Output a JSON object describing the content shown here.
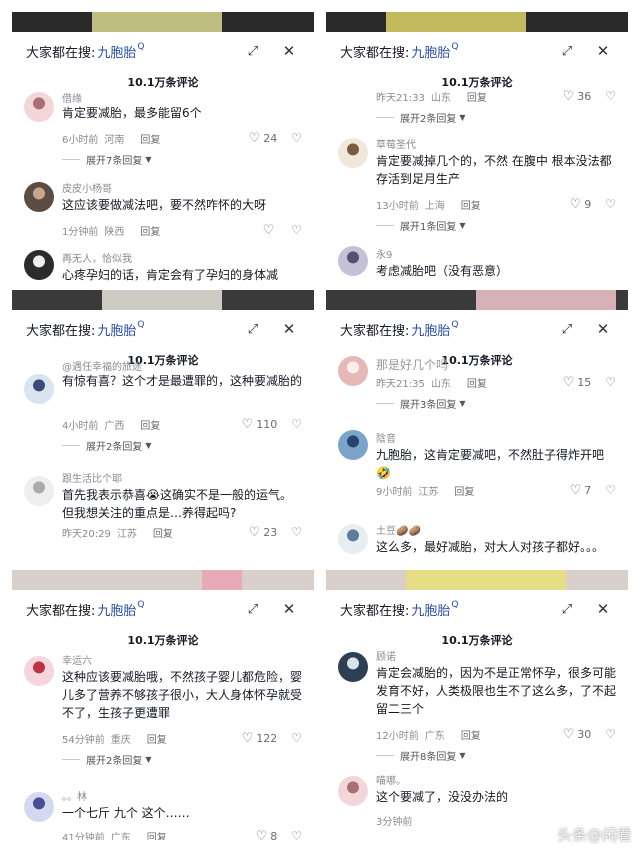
{
  "search_label": "大家都在搜:",
  "search_keyword": "九胞胎",
  "comment_count": "10.1万条评论",
  "watermark": "头条@闲看",
  "panels": [
    {
      "items": [
        {
          "name": "借缘",
          "text": "肯定要减胎，最多能留6个",
          "time": "6小时前",
          "loc": "河南",
          "likes": "24",
          "reply": "回复",
          "expand": "展开7条回复"
        },
        {
          "name": "皮皮小杨哥",
          "text": "这应该要做减法吧，要不然咋怀的大呀",
          "time": "1分钟前",
          "loc": "陕西",
          "likes": "",
          "reply": "回复"
        },
        {
          "name": "再无人，恰似我",
          "text": "心疼孕妇的话，肯定会有了孕妇的身体减"
        }
      ]
    },
    {
      "items": [
        {
          "time": "昨天21:33",
          "loc": "山东",
          "likes": "36",
          "reply": "回复",
          "expand": "展开2条回复"
        },
        {
          "name": "草莓圣代",
          "text": "肯定要减掉几个的，不然 在腹中 根本没法都存活到足月生产",
          "time": "13小时前",
          "loc": "上海",
          "likes": "9",
          "reply": "回复",
          "expand": "展开1条回复"
        },
        {
          "name": "永9",
          "text": "考虑减胎吧（没有恶意）"
        }
      ]
    },
    {
      "items": [
        {
          "name": "@遇任幸福的旅途",
          "text": "有惊有喜？这个才是最遭罪的，这种要减胎的",
          "time": "4小时前",
          "loc": "广西",
          "likes": "110",
          "reply": "回复",
          "expand": "展开2条回复"
        },
        {
          "name": "跟生活比个耶",
          "text": "首先我表示恭喜😭这确实不是一般的运气。但我想关注的重点是…养得起吗?",
          "time": "昨天20:29",
          "loc": "江苏",
          "likes": "23",
          "reply": "回复"
        }
      ]
    },
    {
      "items": [
        {
          "text": "那是好几个吗",
          "time": "昨天21:35",
          "loc": "山东",
          "likes": "15",
          "reply": "回复",
          "expand": "展开3条回复"
        },
        {
          "name": "陰音",
          "text": "九胞胎，这肯定要减吧，不然肚子得炸开吧🤣",
          "time": "9小时前",
          "loc": "江苏",
          "likes": "7",
          "reply": "回复"
        },
        {
          "name": "土豆🥔🥔",
          "text": "这么多，最好减胎，对大人对孩子都好。。。"
        }
      ]
    },
    {
      "items": [
        {
          "name": "幸运六",
          "text": "这种应该要减胎哦，不然孩子婴儿都危险，婴儿多了营养不够孩子很小，大人身体怀孕就受不了，生孩子更遭罪",
          "time": "54分钟前",
          "loc": "重庆",
          "likes": "122",
          "reply": "回复",
          "expand": "展开2条回复"
        },
        {
          "name": "。。林",
          "text": "一个七斤 九个 这个……",
          "time": "41分钟前",
          "loc": "广东",
          "likes": "8",
          "reply": "回复"
        }
      ]
    },
    {
      "items": [
        {
          "name": "顾诺",
          "text": "肯定会减胎的，因为不是正常怀孕，很多可能发育不好，人类极限也生不了这么多，了不起留二三个",
          "time": "12小时前",
          "loc": "广东",
          "likes": "30",
          "reply": "回复",
          "expand": "展开8条回复"
        },
        {
          "name": "喵哪。",
          "text": "这个要减了，没没办法的",
          "time": "3分钟前"
        }
      ]
    }
  ]
}
